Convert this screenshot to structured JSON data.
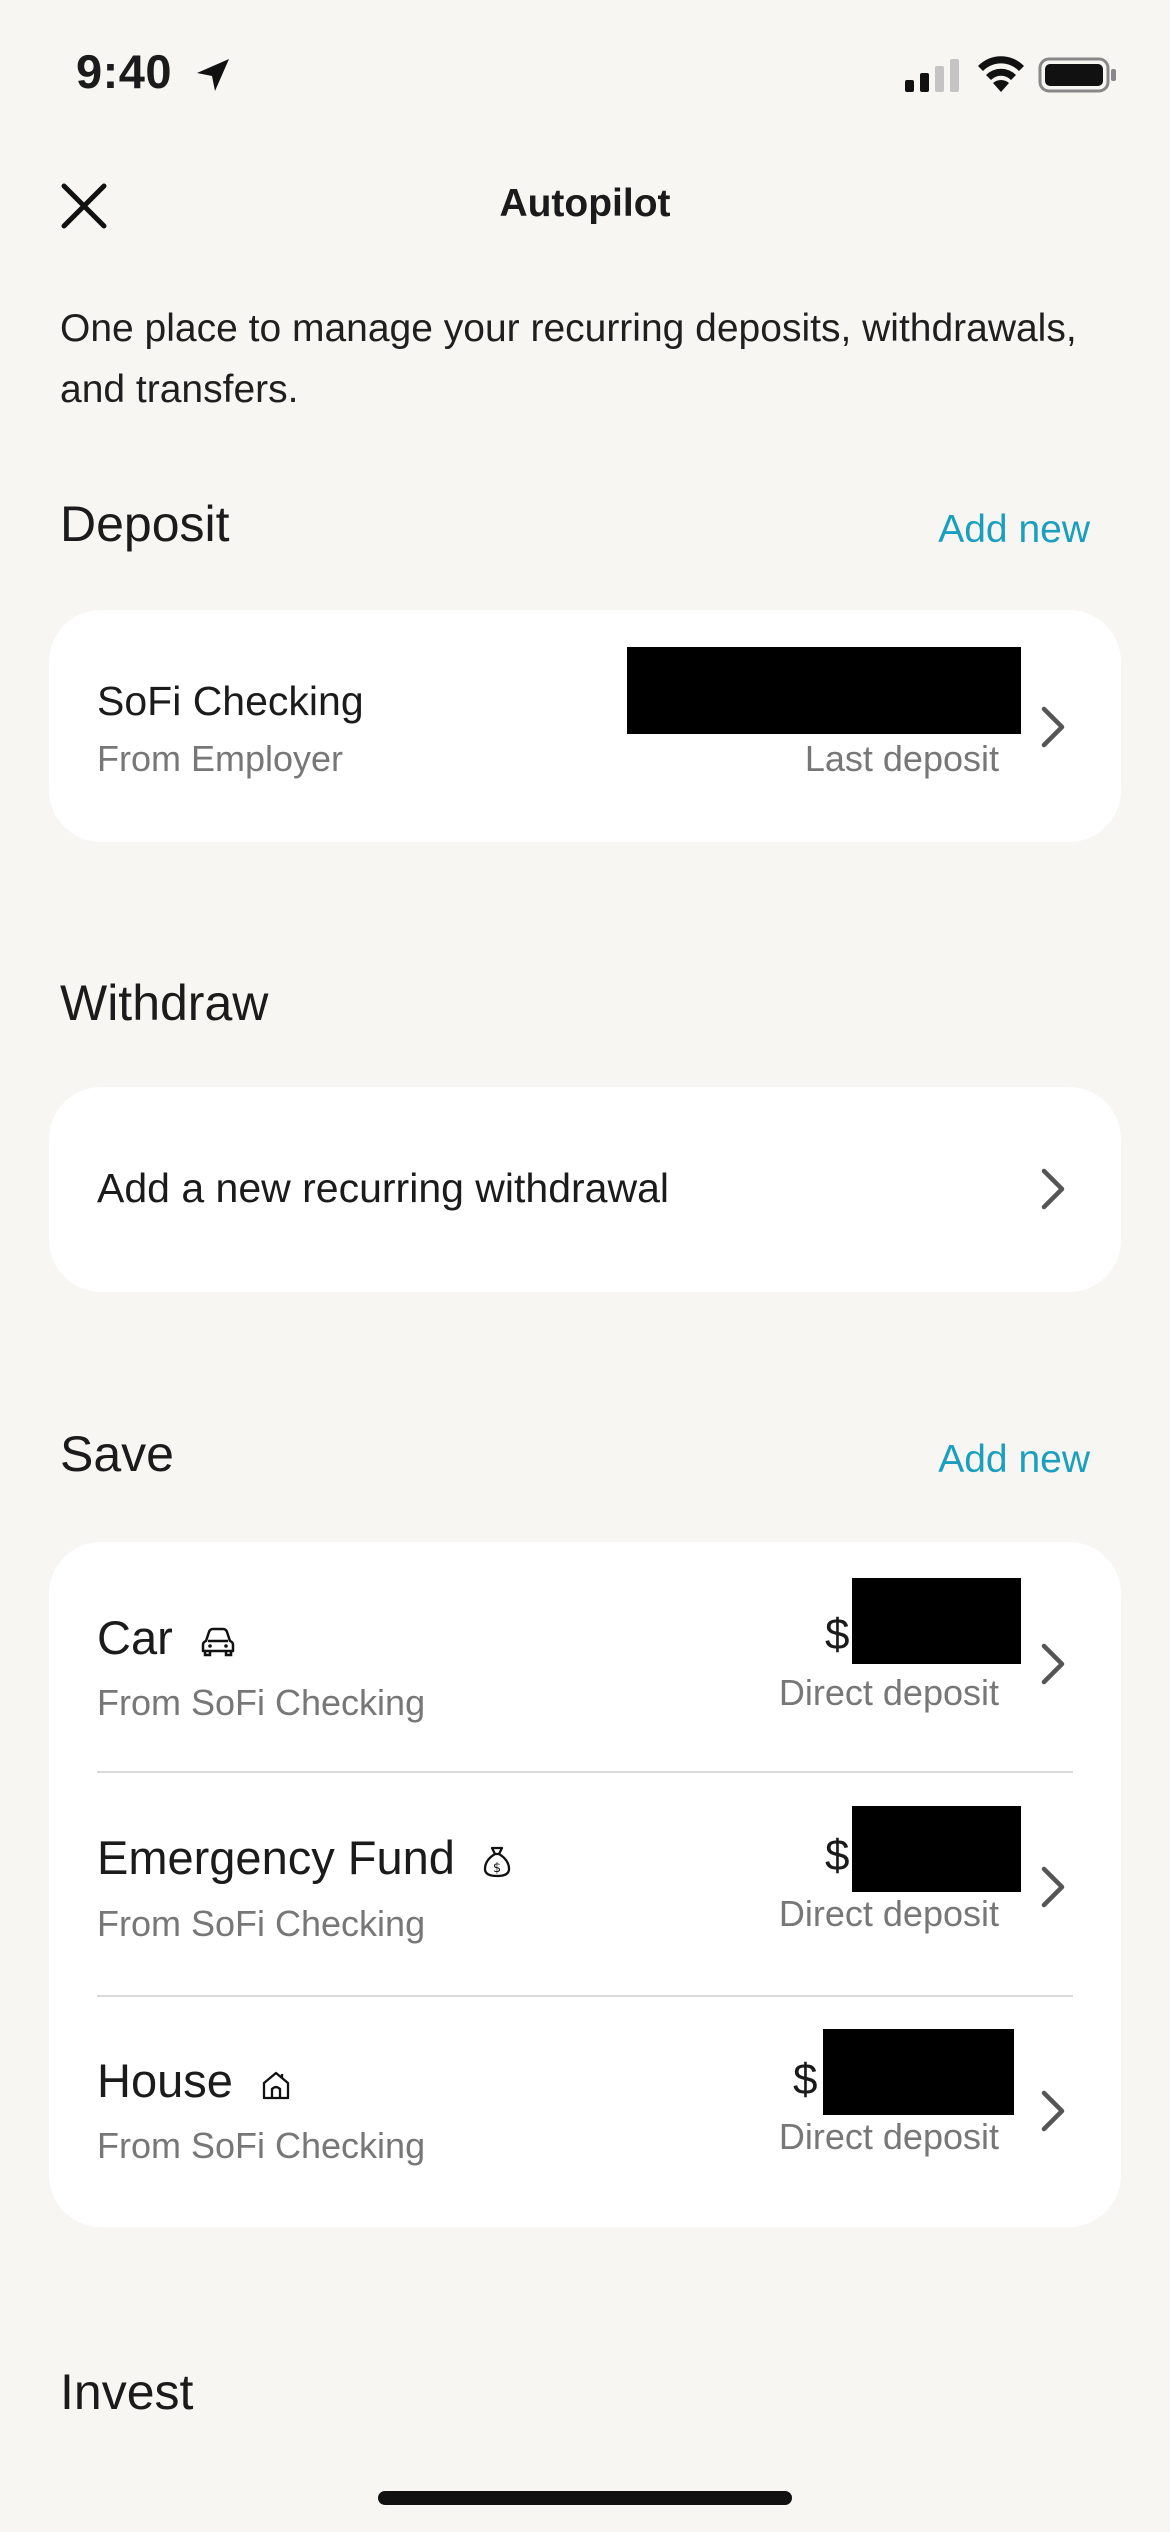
{
  "status_bar": {
    "time": "9:40"
  },
  "nav": {
    "title": "Autopilot"
  },
  "intro": "One place to manage your recurring deposits, withdrawals, and transfers.",
  "deposit": {
    "title": "Deposit",
    "add_label": "Add new",
    "item": {
      "title": "SoFi Checking",
      "subtitle": "From Employer",
      "right_label": "Last deposit"
    }
  },
  "withdraw": {
    "title": "Withdraw",
    "item": {
      "title": "Add a new recurring withdrawal"
    }
  },
  "save": {
    "title": "Save",
    "add_label": "Add new",
    "items": [
      {
        "title": "Car",
        "icon": "car-icon",
        "subtitle": "From SoFi Checking",
        "amount_prefix": "$",
        "right_label": "Direct deposit"
      },
      {
        "title": "Emergency Fund",
        "icon": "money-bag-icon",
        "subtitle": "From SoFi Checking",
        "amount_prefix": "$",
        "right_label": "Direct deposit"
      },
      {
        "title": "House",
        "icon": "house-icon",
        "subtitle": "From SoFi Checking",
        "amount_prefix": "$",
        "right_label": "Direct deposit"
      }
    ]
  },
  "invest": {
    "title": "Invest"
  },
  "colors": {
    "accent": "#1a9fbe",
    "background": "#f7f6f3",
    "card": "#ffffff",
    "redaction": "#000000"
  }
}
